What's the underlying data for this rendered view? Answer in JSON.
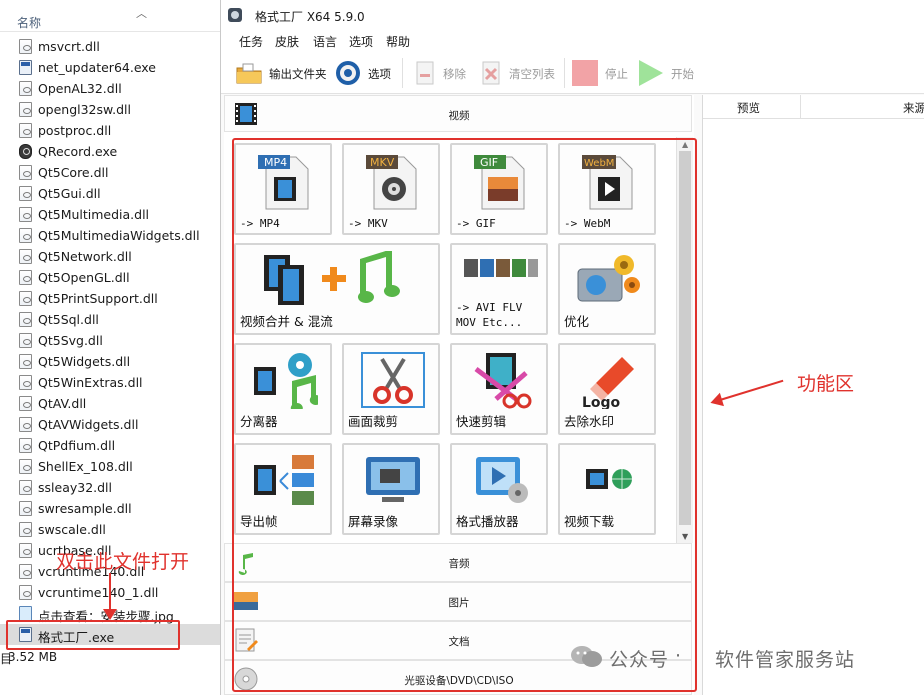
{
  "explorer": {
    "column_name": "名称",
    "files": [
      {
        "name": "msvcrt.dll",
        "icon": "dll"
      },
      {
        "name": "net_updater64.exe",
        "icon": "exe"
      },
      {
        "name": "OpenAL32.dll",
        "icon": "dll"
      },
      {
        "name": "opengl32sw.dll",
        "icon": "dll"
      },
      {
        "name": "postproc.dll",
        "icon": "dll"
      },
      {
        "name": "QRecord.exe",
        "icon": "cam"
      },
      {
        "name": "Qt5Core.dll",
        "icon": "dll"
      },
      {
        "name": "Qt5Gui.dll",
        "icon": "dll"
      },
      {
        "name": "Qt5Multimedia.dll",
        "icon": "dll"
      },
      {
        "name": "Qt5MultimediaWidgets.dll",
        "icon": "dll"
      },
      {
        "name": "Qt5Network.dll",
        "icon": "dll"
      },
      {
        "name": "Qt5OpenGL.dll",
        "icon": "dll"
      },
      {
        "name": "Qt5PrintSupport.dll",
        "icon": "dll"
      },
      {
        "name": "Qt5Sql.dll",
        "icon": "dll"
      },
      {
        "name": "Qt5Svg.dll",
        "icon": "dll"
      },
      {
        "name": "Qt5Widgets.dll",
        "icon": "dll"
      },
      {
        "name": "Qt5WinExtras.dll",
        "icon": "dll"
      },
      {
        "name": "QtAV.dll",
        "icon": "dll"
      },
      {
        "name": "QtAVWidgets.dll",
        "icon": "dll"
      },
      {
        "name": "QtPdfium.dll",
        "icon": "dll"
      },
      {
        "name": "ShellEx_108.dll",
        "icon": "dll"
      },
      {
        "name": "ssleay32.dll",
        "icon": "dll"
      },
      {
        "name": "swresample.dll",
        "icon": "dll"
      },
      {
        "name": "swscale.dll",
        "icon": "dll"
      },
      {
        "name": "ucrtbase.dll",
        "icon": "dll"
      },
      {
        "name": "vcruntime140.dll",
        "icon": "dll"
      },
      {
        "name": "vcruntime140_1.dll",
        "icon": "dll"
      },
      {
        "name": "点击查看：安装步骤.jpg",
        "icon": "jpg"
      },
      {
        "name": "格式工厂.exe",
        "icon": "exe",
        "selected": true
      }
    ],
    "status_left": "目",
    "status_size": "3.52 MB"
  },
  "annotations": {
    "dblclick": "双击此文件打开",
    "func_area": "功能区"
  },
  "app": {
    "title": "格式工厂 X64 5.9.0",
    "menu": [
      "任务",
      "皮肤",
      "语言",
      "选项",
      "帮助"
    ],
    "toolbar": {
      "output_folder": "输出文件夹",
      "options": "选项",
      "remove": "移除",
      "clear_list": "清空列表",
      "stop": "停止",
      "start": "开始"
    },
    "categories": {
      "video": "视频",
      "audio": "音频",
      "image": "图片",
      "document": "文档",
      "disc": "光驱设备\\DVD\\CD\\ISO"
    },
    "tiles": {
      "mp4": {
        "badge": "MP4",
        "label": "-> MP4"
      },
      "mkv": {
        "badge": "MKV",
        "label": "-> MKV"
      },
      "gif": {
        "badge": "GIF",
        "label": "-> GIF"
      },
      "webm": {
        "badge": "WebM",
        "label": "-> WebM"
      },
      "merge": {
        "label": "视频合并 & 混流"
      },
      "avi": {
        "line1": "-> AVI FLV",
        "line2": "MOV Etc..."
      },
      "optimize": {
        "label": "优化"
      },
      "splitter": {
        "label": "分离器"
      },
      "crop": {
        "label": "画面裁剪"
      },
      "quick_cut": {
        "label": "快速剪辑"
      },
      "remove_logo": {
        "label": "去除水印",
        "logo_text": "Logo"
      },
      "export_frames": {
        "label": "导出帧"
      },
      "screen_record": {
        "label": "屏幕录像"
      },
      "player": {
        "label": "格式播放器"
      },
      "download": {
        "label": "视频下载"
      }
    },
    "task_columns": {
      "preview": "预览",
      "source": "来源"
    }
  },
  "watermark": {
    "text": "公众号",
    "separator": "·",
    "name": "软件管家服务站"
  },
  "colors": {
    "annotation": "#e0322d",
    "accent": "#2b7fd8"
  }
}
